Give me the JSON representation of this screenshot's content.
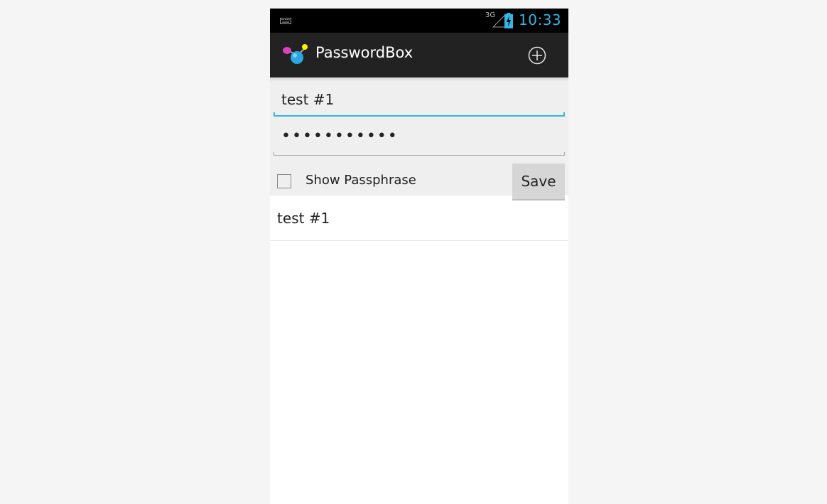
{
  "status_bar": {
    "network_type": "3G",
    "time": "10:33",
    "keyboard_icon": "keyboard-icon",
    "signal_icon": "signal-icon",
    "battery_icon": "battery-charging-icon",
    "clock_color": "#33b5e5"
  },
  "action_bar": {
    "title": "PasswordBox",
    "app_icon": "app-logo-icon",
    "add_icon": "add-circle-icon"
  },
  "form": {
    "title_value": "test #1",
    "passphrase_value": "•••••••••••",
    "show_passphrase_label": "Show Passphrase",
    "show_passphrase_checked": false,
    "save_label": "Save",
    "accent_color": "#33b5e5"
  },
  "entries": [
    {
      "label": "test #1"
    }
  ]
}
